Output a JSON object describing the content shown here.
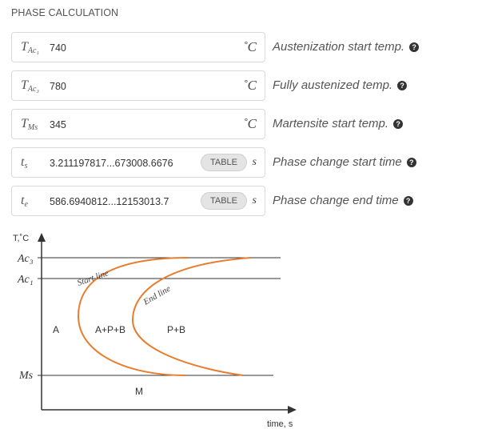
{
  "section_title": "PHASE CALCULATION",
  "fields": [
    {
      "sym_main": "T",
      "sym_sub": "Ac₁",
      "value": "740",
      "unit": "˚C",
      "description": "Austenization start temp."
    },
    {
      "sym_main": "T",
      "sym_sub": "Ac₃",
      "value": "780",
      "unit": "˚C",
      "description": "Fully austenized temp."
    },
    {
      "sym_main": "T",
      "sym_sub": "Ms",
      "value": "345",
      "unit": "˚C",
      "description": "Martensite start temp."
    },
    {
      "sym_main": "t",
      "sym_sub": "s",
      "value": "3.211197817...673008.6676",
      "button": "TABLE",
      "unit": "s",
      "description": "Phase change start time"
    },
    {
      "sym_main": "t",
      "sym_sub": "e",
      "value": "586.6940812...12153013.7",
      "button": "TABLE",
      "unit": "s",
      "description": "Phase change end time"
    }
  ],
  "help_glyph": "?",
  "diagram": {
    "y_axis_label": "T,˚C",
    "x_axis_label": "time, s",
    "ac3_label": "Ac₃",
    "ac1_label": "Ac₁",
    "ms_label": "Ms",
    "start_line_label": "Start line",
    "end_line_label": "End line",
    "region_a": "A",
    "region_apb": "A+P+B",
    "region_pb": "P+B",
    "region_m": "M",
    "curve_color": "#e87d2f"
  }
}
